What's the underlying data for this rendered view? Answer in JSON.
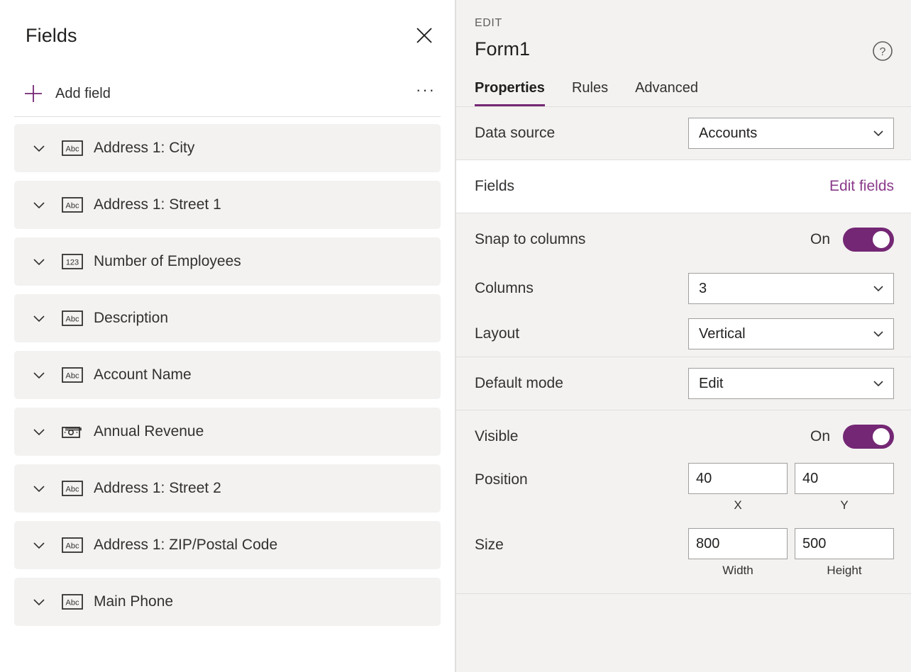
{
  "left_panel": {
    "title": "Fields",
    "close_icon": "close-icon",
    "add_field_label": "Add field",
    "plus_icon": "plus-icon",
    "more_options_label": "···",
    "fields": [
      {
        "name": "Address 1: City",
        "type_icon": "text-abc-icon"
      },
      {
        "name": "Address 1: Street 1",
        "type_icon": "text-abc-icon"
      },
      {
        "name": "Number of Employees",
        "type_icon": "number-123-icon"
      },
      {
        "name": "Description",
        "type_icon": "text-abc-icon"
      },
      {
        "name": "Account Name",
        "type_icon": "text-abc-icon"
      },
      {
        "name": "Annual Revenue",
        "type_icon": "currency-icon"
      },
      {
        "name": "Address 1: Street 2",
        "type_icon": "text-abc-icon"
      },
      {
        "name": "Address 1: ZIP/Postal Code",
        "type_icon": "text-abc-icon"
      },
      {
        "name": "Main Phone",
        "type_icon": "text-abc-icon"
      }
    ]
  },
  "right_panel": {
    "eyebrow": "EDIT",
    "title": "Form1",
    "help_icon": "help-circle-icon",
    "tabs": [
      {
        "label": "Properties",
        "active": true
      },
      {
        "label": "Rules",
        "active": false
      },
      {
        "label": "Advanced",
        "active": false
      }
    ],
    "properties": {
      "data_source": {
        "label": "Data source",
        "value": "Accounts"
      },
      "fields": {
        "label": "Fields",
        "action_label": "Edit fields"
      },
      "snap_to_columns": {
        "label": "Snap to columns",
        "state": "On",
        "value": true
      },
      "columns": {
        "label": "Columns",
        "value": "3"
      },
      "layout": {
        "label": "Layout",
        "value": "Vertical"
      },
      "default_mode": {
        "label": "Default mode",
        "value": "Edit"
      },
      "visible": {
        "label": "Visible",
        "state": "On",
        "value": true
      },
      "position": {
        "label": "Position",
        "x": {
          "value": "40",
          "caption": "X"
        },
        "y": {
          "value": "40",
          "caption": "Y"
        }
      },
      "size": {
        "label": "Size",
        "width": {
          "value": "800",
          "caption": "Width"
        },
        "height": {
          "value": "500",
          "caption": "Height"
        }
      }
    }
  },
  "colors": {
    "accent_purple": "#742774",
    "link_purple": "#8a3a8a",
    "row_gray": "#f3f2f1",
    "border_gray": "#e1dfdd",
    "text_primary": "#201f1e",
    "text_secondary": "#605e5c"
  }
}
